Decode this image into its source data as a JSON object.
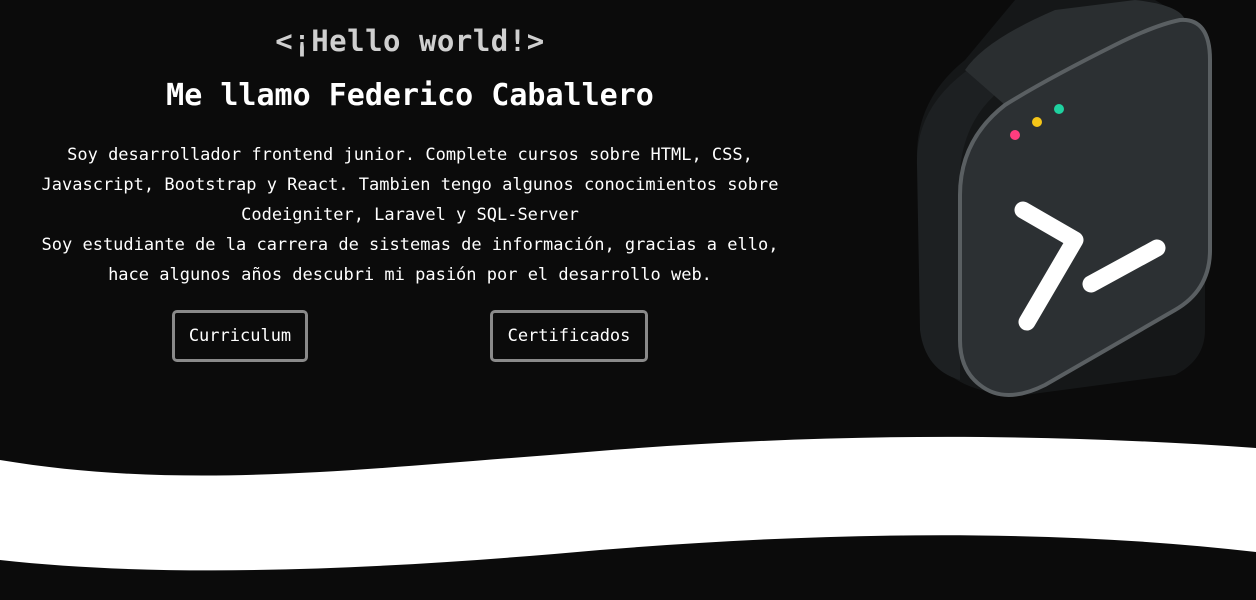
{
  "hero": {
    "greeting": "<¡Hello world!>",
    "name": "Me llamo Federico Caballero",
    "intro_lines": [
      "Soy desarrollador frontend junior. Complete cursos sobre HTML, CSS,",
      "Javascript, Bootstrap y React. Tambien tengo algunos conocimientos sobre",
      "Codeigniter, Laravel y SQL-Server",
      "Soy estudiante de la carrera de sistemas de información, gracias a ello,",
      "hace algunos años descubri mi pasión por el desarrollo web."
    ],
    "buttons": {
      "curriculum": "Curriculum",
      "certificados": "Certificados"
    }
  },
  "illustration": {
    "icon": "terminal-icon",
    "dot_colors": [
      "#ff3d7f",
      "#f5c518",
      "#1fd1a0"
    ]
  },
  "colors": {
    "background": "#0b0b0b",
    "wave": "#ffffff",
    "button_border": "#8a8a8a"
  }
}
